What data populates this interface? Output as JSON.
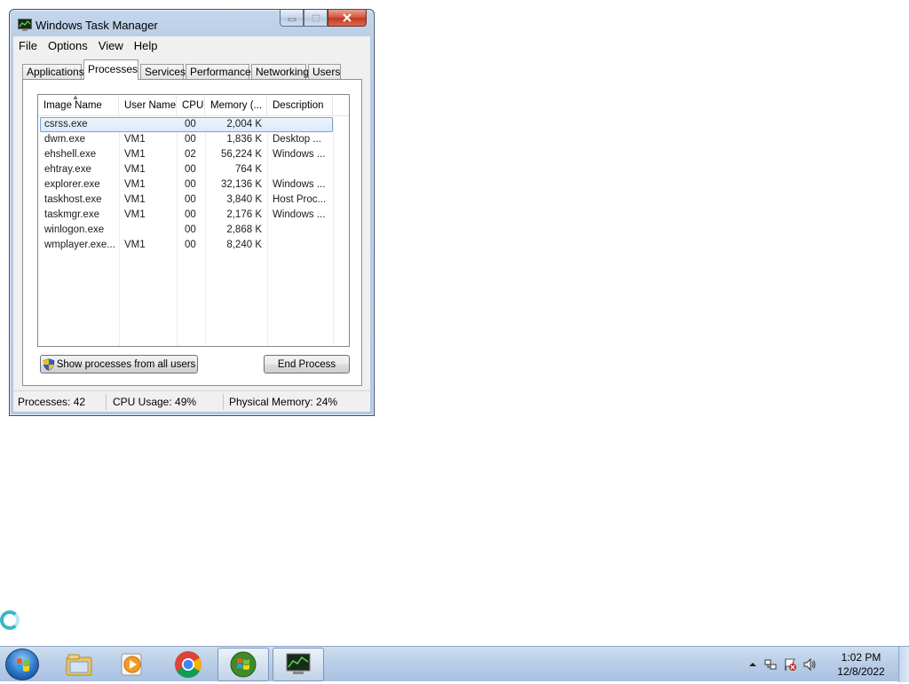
{
  "window": {
    "title": "Windows Task Manager",
    "menu": [
      "File",
      "Options",
      "View",
      "Help"
    ],
    "tabs": [
      "Applications",
      "Processes",
      "Services",
      "Performance",
      "Networking",
      "Users"
    ],
    "active_tab": "Processes",
    "columns": [
      "Image Name",
      "User Name",
      "CPU",
      "Memory (...",
      "Description"
    ],
    "processes": [
      {
        "name": "csrss.exe",
        "user": "",
        "cpu": "00",
        "memory": "2,004 K",
        "description": "",
        "selected": true
      },
      {
        "name": "dwm.exe",
        "user": "VM1",
        "cpu": "00",
        "memory": "1,836 K",
        "description": "Desktop ..."
      },
      {
        "name": "ehshell.exe",
        "user": "VM1",
        "cpu": "02",
        "memory": "56,224 K",
        "description": "Windows ..."
      },
      {
        "name": "ehtray.exe",
        "user": "VM1",
        "cpu": "00",
        "memory": "764 K",
        "description": ""
      },
      {
        "name": "explorer.exe",
        "user": "VM1",
        "cpu": "00",
        "memory": "32,136 K",
        "description": "Windows ..."
      },
      {
        "name": "taskhost.exe",
        "user": "VM1",
        "cpu": "00",
        "memory": "3,840 K",
        "description": "Host Proc..."
      },
      {
        "name": "taskmgr.exe",
        "user": "VM1",
        "cpu": "00",
        "memory": "2,176 K",
        "description": "Windows ..."
      },
      {
        "name": "winlogon.exe",
        "user": "",
        "cpu": "00",
        "memory": "2,868 K",
        "description": ""
      },
      {
        "name": "wmplayer.exe...",
        "user": "VM1",
        "cpu": "00",
        "memory": "8,240 K",
        "description": ""
      }
    ],
    "show_all_label": "Show processes from all users",
    "end_process_label": "End Process",
    "status": {
      "processes": "Processes: 42",
      "cpu": "CPU Usage: 49%",
      "memory": "Physical Memory: 24%"
    }
  },
  "taskbar": {
    "pinned": [
      "start-orb",
      "file-explorer-icon",
      "media-player-icon",
      "chrome-icon",
      "windows-media-center-icon",
      "task-manager-icon"
    ],
    "clock_time": "1:02 PM",
    "clock_date": "12/8/2022",
    "tray_icons": [
      "show-hidden-icons-chevron",
      "action-center-flag-icon",
      "network-icon",
      "volume-icon"
    ]
  },
  "colors": {
    "selection": "#dbeaf9",
    "close_button": "#c3371f",
    "taskbar": "#b8cde6"
  }
}
